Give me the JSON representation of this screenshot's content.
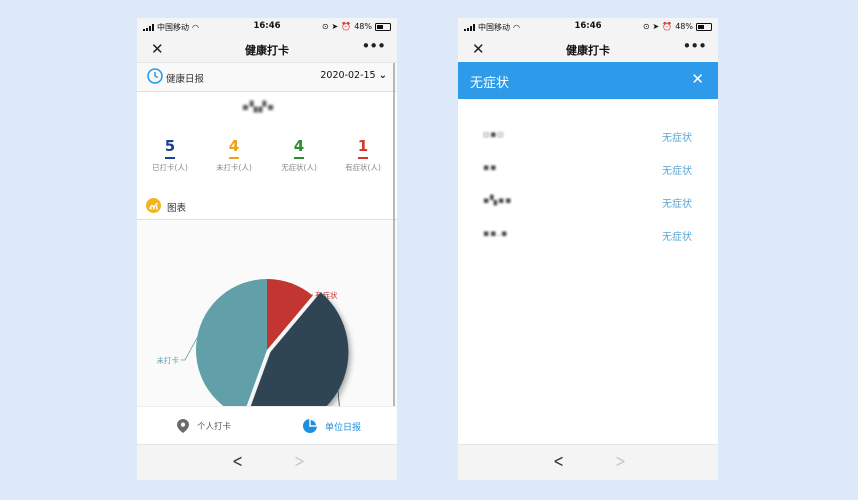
{
  "status_bar": {
    "carrier": "中国移动",
    "time": "16:46",
    "battery": "48%"
  },
  "left": {
    "nav_title": "健康打卡",
    "header_label": "健康日报",
    "date": "2020-02-15",
    "unit_name": "▪▚▞▪",
    "stats": [
      {
        "value": "5",
        "label": "已打卡(人)",
        "color": "#1b3f91"
      },
      {
        "value": "4",
        "label": "未打卡(人)",
        "color": "#f0a11c"
      },
      {
        "value": "4",
        "label": "无症状(人)",
        "color": "#2b8f2b"
      },
      {
        "value": "1",
        "label": "有症状(人)",
        "color": "#d43a2a"
      }
    ],
    "chart_label": "图表",
    "tabs": {
      "personal": "个人打卡",
      "unit": "单位日报"
    }
  },
  "right": {
    "nav_title": "健康打卡",
    "header_title": "无症状",
    "items": [
      {
        "name": "▫▪▫",
        "status": "无症状"
      },
      {
        "name": "▪▪",
        "status": "无症状"
      },
      {
        "name": "▪▚▪▪",
        "status": "无症状"
      },
      {
        "name": "▪▪.▪",
        "status": "无症状"
      }
    ]
  },
  "chart_data": {
    "type": "pie",
    "slices": [
      {
        "label": "有症状",
        "value": 1,
        "color": "#c23531"
      },
      {
        "label": "无症状",
        "value": 4,
        "color": "#2f4554"
      },
      {
        "label": "未打卡",
        "value": 4,
        "color": "#61a0a8"
      }
    ],
    "highlighted": "无症状"
  },
  "colors": {
    "accent": "#2d9bea",
    "link": "#5aa5d8"
  },
  "icons": {
    "close": "close-icon",
    "more": "more-icon",
    "clock": "clock-icon",
    "chart": "chart-icon",
    "location": "location-pin-icon",
    "unit_report": "pie-chart-icon",
    "back": "chevron-left-icon",
    "forward": "chevron-right-icon"
  }
}
